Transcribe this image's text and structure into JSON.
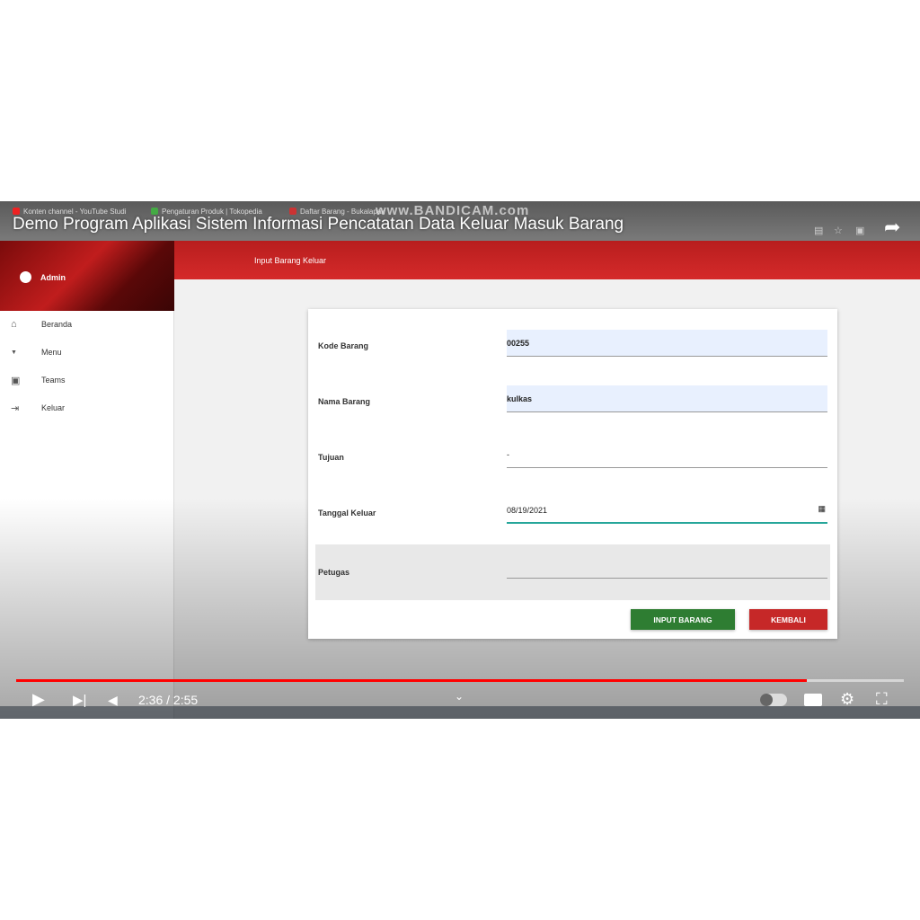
{
  "video": {
    "title": "Demo Program Aplikasi Sistem Informasi Pencatatan Data Keluar Masuk Barang",
    "watermark": "www.BANDICAM.com",
    "current_time": "2:36",
    "duration": "2:55",
    "time_display": "2:36 / 2:55",
    "progress": 0.891,
    "progress_color": "#ff0000"
  },
  "browser": {
    "tabs": [
      "Konten channel - YouTube Studi",
      "Pengaturan Produk | Tokopedia",
      "Daftar Barang - Bukalapak"
    ]
  },
  "app": {
    "page_title": "Input Barang Keluar",
    "user": "Admin",
    "sidebar": [
      {
        "icon": "home-icon",
        "label": "Beranda"
      },
      {
        "icon": "caret-down-icon",
        "label": "Menu"
      },
      {
        "icon": "contacts-icon",
        "label": "Teams"
      },
      {
        "icon": "logout-icon",
        "label": "Keluar"
      }
    ],
    "form": {
      "fields": [
        {
          "label": "Kode Barang",
          "value": "00255"
        },
        {
          "label": "Nama Barang",
          "value": "kulkas"
        },
        {
          "label": "Tujuan",
          "value": "-"
        },
        {
          "label": "Tanggal Keluar",
          "value": "08/19/2021"
        },
        {
          "label": "Petugas",
          "value": ""
        }
      ],
      "submit": "INPUT BARANG",
      "back": "KEMBALI"
    },
    "colors": {
      "primary": "#c62828",
      "submit": "#2e7d32"
    }
  }
}
